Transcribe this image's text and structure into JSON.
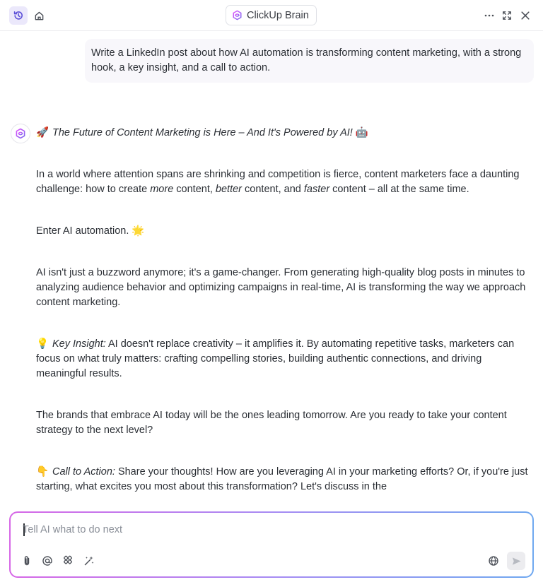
{
  "header": {
    "title": "ClickUp Brain",
    "icons": [
      "history-icon",
      "home-icon",
      "brain-logo-icon",
      "more-icon",
      "expand-icon",
      "close-icon"
    ]
  },
  "conversation": {
    "user_message": "Write a LinkedIn post about how AI automation is transforming content marketing, with a strong hook, a key insight, and a call to action.",
    "ai_response": {
      "title_emoji": "🚀",
      "title": "The Future of Content Marketing is Here – And It's Powered by AI!",
      "title_end_emoji": "🤖",
      "p1_a": "In a world where attention spans are shrinking and competition is fierce, content marketers face a daunting challenge: how to create ",
      "p1_more": "more",
      "p1_b": " content, ",
      "p1_better": "better",
      "p1_c": " content, and ",
      "p1_faster": "faster",
      "p1_d": " content – all at the same time.",
      "p2": "Enter AI automation.",
      "p2_emoji": "🌟",
      "p3": "AI isn't just a buzzword anymore; it's a game-changer. From generating high-quality blog posts in minutes to analyzing audience behavior and optimizing campaigns in real-time, AI is transforming the way we approach content marketing.",
      "p4_emoji": "💡",
      "p4_label": "Key Insight:",
      "p4": " AI doesn't replace creativity – it amplifies it. By automating repetitive tasks, marketers can focus on what truly matters: crafting compelling stories, building authentic connections, and driving meaningful results.",
      "p5": "The brands that embrace AI today will be the ones leading tomorrow. Are you ready to take your content strategy to the next level?",
      "p6_emoji": "👇",
      "p6_label": "Call to Action:",
      "p6": " Share your thoughts! How are you leveraging AI in your marketing efforts? Or, if you're just starting, what excites you most about this transformation? Let's discuss in the"
    }
  },
  "composer": {
    "placeholder": "Tell AI what to do next",
    "value": "",
    "tools": [
      "attach-icon",
      "mention-icon",
      "integrations-icon",
      "magic-icon"
    ],
    "right_tools": [
      "globe-icon",
      "send-icon"
    ]
  },
  "colors": {
    "accent": "#7b68ee",
    "brand_gradient_start": "#d667e6",
    "brand_gradient_end": "#6fa8f0"
  }
}
